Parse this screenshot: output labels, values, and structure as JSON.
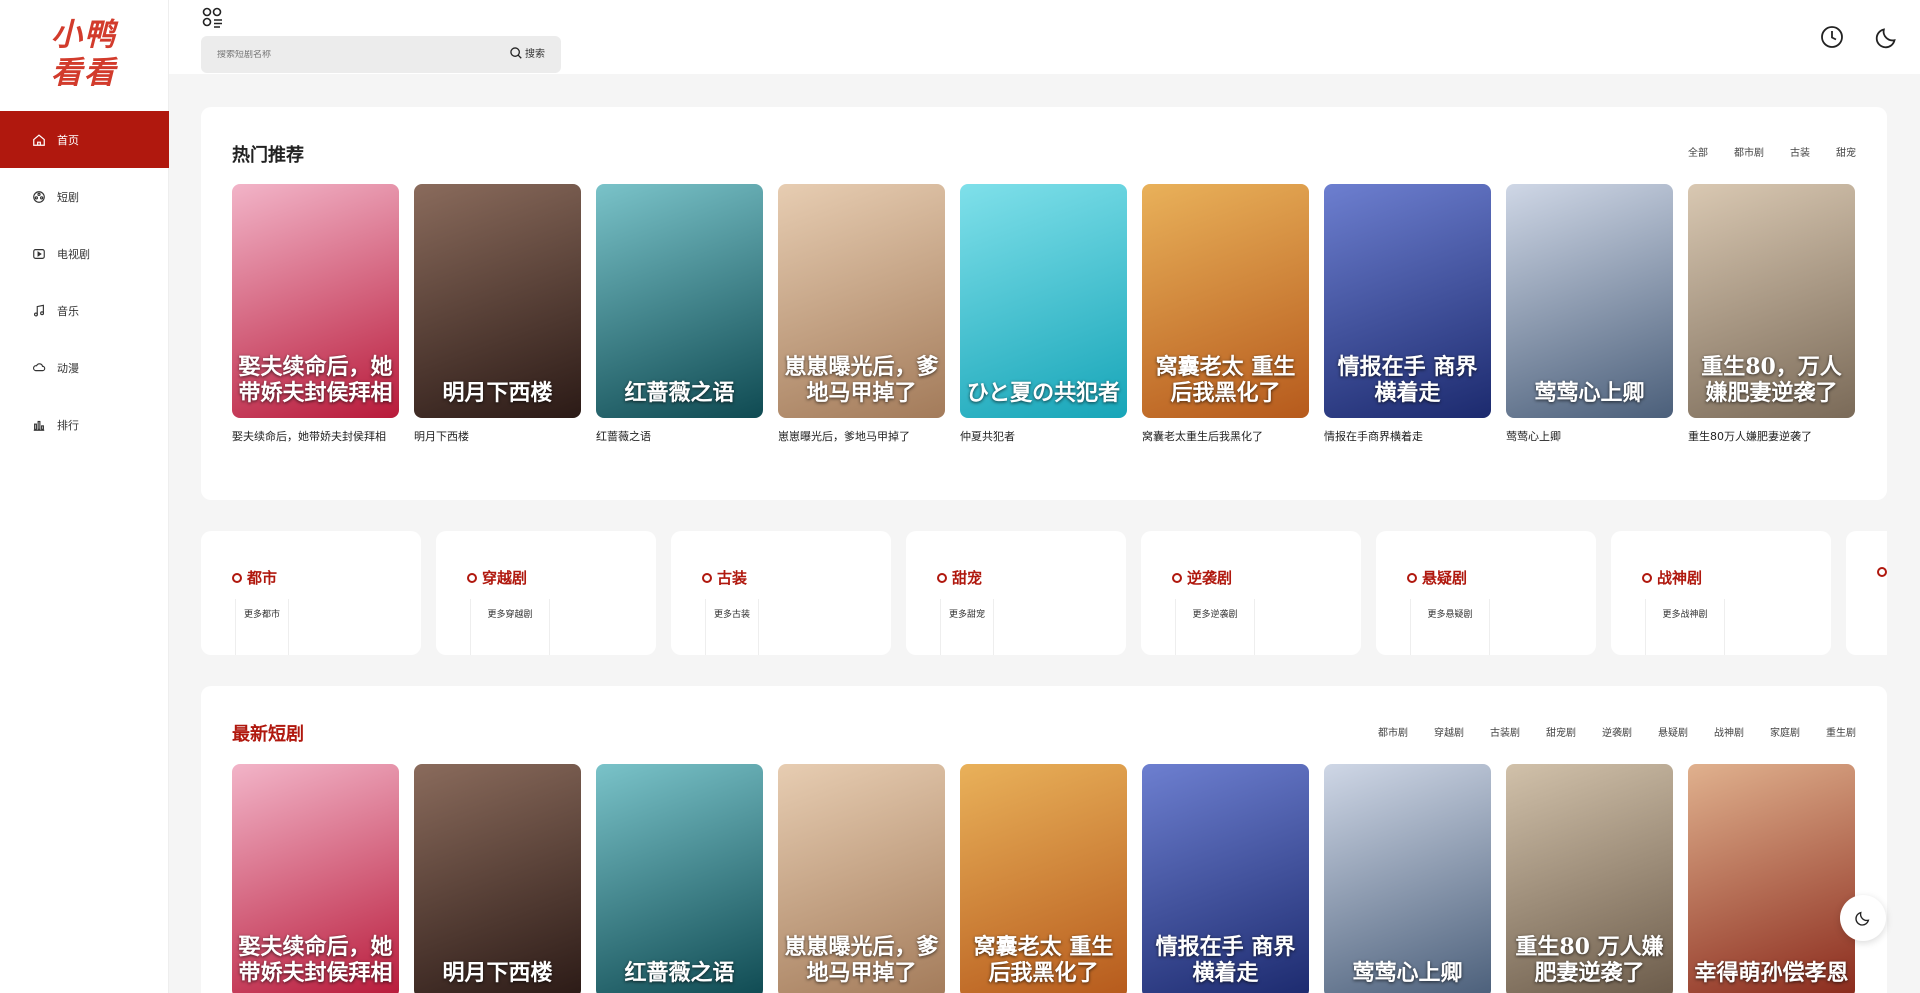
{
  "logo": {
    "line1": "小鸭",
    "line2": "看看"
  },
  "sidebar": {
    "items": [
      {
        "label": "首页",
        "icon": "home-icon"
      },
      {
        "label": "短剧",
        "icon": "film-reel-icon"
      },
      {
        "label": "电视剧",
        "icon": "tv-play-icon"
      },
      {
        "label": "音乐",
        "icon": "music-note-icon"
      },
      {
        "label": "动漫",
        "icon": "cloud-icon"
      },
      {
        "label": "排行",
        "icon": "bar-chart-icon"
      }
    ]
  },
  "search": {
    "placeholder": "搜索短剧名称",
    "button_label": "搜索"
  },
  "hot": {
    "title": "热门推荐",
    "links": [
      "全部",
      "都市剧",
      "古装",
      "甜宠"
    ],
    "items": [
      {
        "title": "娶夫续命后，她带娇夫封侯拜相",
        "poster_text": "娶夫续命后，她带娇夫封侯拜相",
        "color_a": "#b81a3a",
        "color_b": "#f2b4c8"
      },
      {
        "title": "明月下西楼",
        "poster_text": "明月下西楼",
        "color_a": "#2b1a16",
        "color_b": "#8a6b5c"
      },
      {
        "title": "红蔷薇之语",
        "poster_text": "红蔷薇之语",
        "color_a": "#0f4a52",
        "color_b": "#7ac3c9"
      },
      {
        "title": "崽崽曝光后，爹地马甲掉了",
        "poster_text": "崽崽曝光后，爹地马甲掉了",
        "color_a": "#a37b5a",
        "color_b": "#e7cdb2"
      },
      {
        "title": "仲夏共犯者",
        "poster_text": "ひと夏の共犯者",
        "color_a": "#17a5b8",
        "color_b": "#7fe0ea"
      },
      {
        "title": "窝囊老太重生后我黑化了",
        "poster_text": "窝囊老太 重生后我黑化了",
        "color_a": "#b65a1c",
        "color_b": "#e9b15a"
      },
      {
        "title": "情报在手商界横着走",
        "poster_text": "情报在手 商界横着走",
        "color_a": "#1c2a6e",
        "color_b": "#6d7fd0"
      },
      {
        "title": "莺莺心上卿",
        "poster_text": "莺莺心上卿",
        "color_a": "#4b5f7a",
        "color_b": "#cfd7e6"
      },
      {
        "title": "重生80万人嫌肥妻逆袭了",
        "poster_text": "重生80，万人嫌肥妻逆袭了",
        "color_a": "#7a6a58",
        "color_b": "#d9c8b2"
      }
    ]
  },
  "categories": [
    {
      "name": "都市",
      "sub": "更多都市"
    },
    {
      "name": "穿越剧",
      "sub": "更多穿越剧"
    },
    {
      "name": "古装",
      "sub": "更多古装"
    },
    {
      "name": "甜宠",
      "sub": "更多甜宠"
    },
    {
      "name": "逆袭剧",
      "sub": "更多逆袭剧"
    },
    {
      "name": "悬疑剧",
      "sub": "更多悬疑剧"
    },
    {
      "name": "战神剧",
      "sub": "更多战神剧"
    }
  ],
  "latest": {
    "title": "最新短剧",
    "links": [
      "都市剧",
      "穿越剧",
      "古装剧",
      "甜宠剧",
      "逆袭剧",
      "悬疑剧",
      "战神剧",
      "家庭剧",
      "重生剧"
    ],
    "items": [
      {
        "poster_text": "娶夫续命后，她带娇夫封侯拜相",
        "color_a": "#b81a3a",
        "color_b": "#f2b4c8"
      },
      {
        "poster_text": "明月下西楼",
        "color_a": "#2b1a16",
        "color_b": "#8a6b5c"
      },
      {
        "poster_text": "红蔷薇之语",
        "color_a": "#0f4a52",
        "color_b": "#7ac3c9"
      },
      {
        "poster_text": "崽崽曝光后，爹地马甲掉了",
        "color_a": "#a37b5a",
        "color_b": "#e7cdb2"
      },
      {
        "poster_text": "窝囊老太 重生后我黑化了",
        "color_a": "#b65a1c",
        "color_b": "#e9b15a"
      },
      {
        "poster_text": "情报在手 商界横着走",
        "color_a": "#1c2a6e",
        "color_b": "#6d7fd0"
      },
      {
        "poster_text": "莺莺心上卿",
        "color_a": "#4b5f7a",
        "color_b": "#cfd7e6"
      },
      {
        "poster_text": "重生80 万人嫌肥妻逆袭了",
        "color_a": "#6b5b4a",
        "color_b": "#d1c1aa"
      },
      {
        "poster_text": "幸得萌孙偿孝恩",
        "color_a": "#8a2a1c",
        "color_b": "#e0b18e"
      }
    ]
  },
  "colors": {
    "accent": "#b0180e",
    "logo": "#d23b2c"
  }
}
